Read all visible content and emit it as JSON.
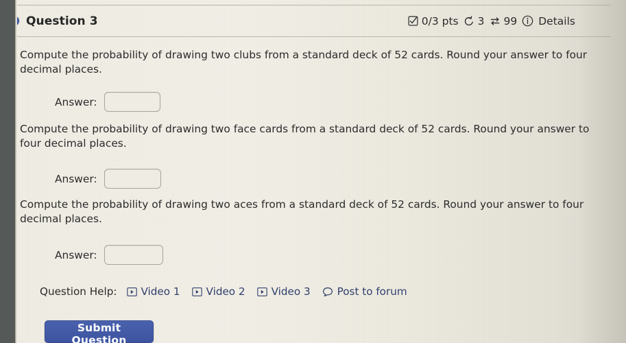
{
  "header": {
    "status_dot_color": "#4255a6",
    "title": "Question 3",
    "points": "0/3 pts",
    "attempts_count": "3",
    "exchange_count": "99",
    "details_label": "Details",
    "icons": {
      "checkbox": "checkbox-checked-icon",
      "attempts": "rotate-ccw-icon",
      "exchange": "exchange-arrows-icon",
      "info": "info-circle-icon"
    }
  },
  "questions": [
    {
      "prompt": "Compute the probability of drawing two clubs from a standard deck of 52 cards. Round your answer to four decimal places.",
      "answer_label": "Answer:",
      "answer_value": "",
      "answer_placeholder": ""
    },
    {
      "prompt": "Compute the probability of drawing two face cards from a standard deck of 52 cards. Round your answer to four decimal places.",
      "answer_label": "Answer:",
      "answer_value": "",
      "answer_placeholder": ""
    },
    {
      "prompt": "Compute the probability of drawing two aces from a standard deck of 52 cards. Round your answer to four decimal places.",
      "answer_label": "Answer:",
      "answer_value": "",
      "answer_placeholder": ""
    }
  ],
  "help": {
    "label": "Question Help:",
    "links": [
      {
        "text": "Video 1",
        "icon": "video-play-icon"
      },
      {
        "text": "Video 2",
        "icon": "video-play-icon"
      },
      {
        "text": "Video 3",
        "icon": "video-play-icon"
      },
      {
        "text": "Post to forum",
        "icon": "speech-bubble-icon"
      }
    ]
  },
  "submit": {
    "label": "Submit Question",
    "color": "#4159a6"
  }
}
